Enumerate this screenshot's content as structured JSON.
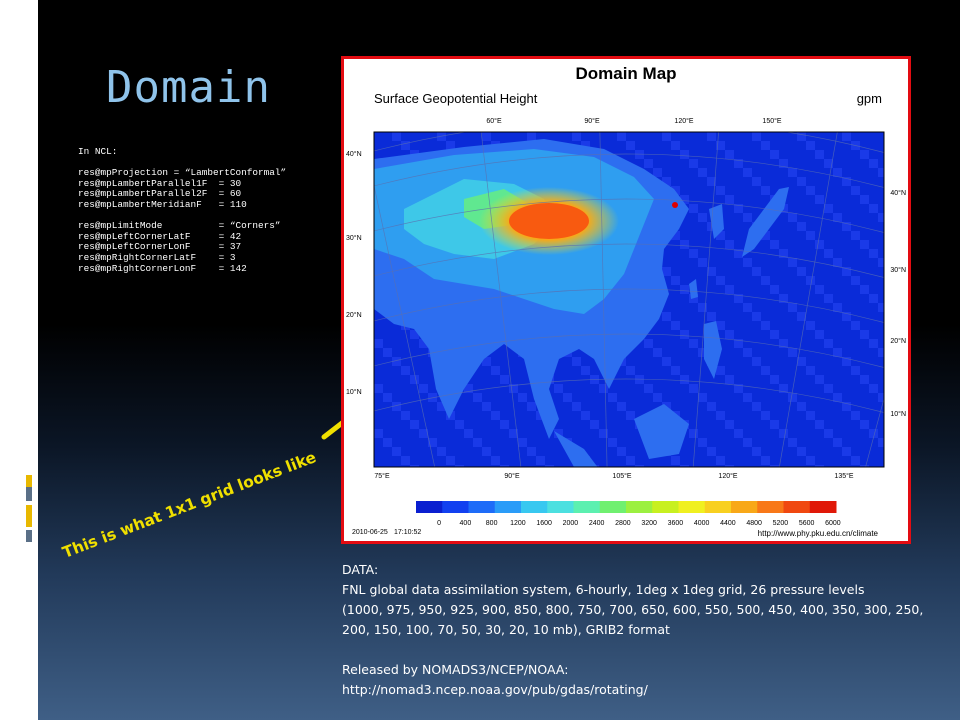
{
  "slide": {
    "title": "Domain",
    "code_lines": [
      "In NCL:",
      "",
      "res@mpProjection = “LambertConformal”",
      "res@mpLambertParallel1F  = 30",
      "res@mpLambertParallel2F  = 60",
      "res@mpLambertMeridianF   = 110",
      "",
      "res@mpLimitMode          = “Corners”",
      "res@mpLeftCornerLatF     = 42",
      "res@mpLeftCornerLonF     = 37",
      "res@mpRightCornerLatF    = 3",
      "res@mpRightCornerLonF    = 142"
    ],
    "caption": "This is what 1x1 grid looks like",
    "data_text": {
      "heading": "DATA:",
      "line1": "FNL global data assimilation system, 6-hourly, 1deg x 1deg grid, 26 pressure levels",
      "line2": "(1000, 975, 950, 925, 900, 850, 800, 750, 700, 650, 600, 550, 500, 450, 400, 350, 300, 250,",
      "line3": "200, 150, 100, 70, 50, 30, 20, 10 mb), GRIB2 format",
      "released": "Released by NOMADS3/NCEP/NOAA:",
      "url": "http://nomad3.ncep.noaa.gov/pub/gdas/rotating/"
    }
  },
  "map": {
    "title": "Domain Map",
    "subtitle": "Surface Geopotential Height",
    "units": "gpm",
    "top_lon_labels": [
      "60°E",
      "90°E",
      "120°E",
      "150°E"
    ],
    "bottom_lon_labels": [
      "75°E",
      "90°E",
      "105°E",
      "120°E",
      "135°E"
    ],
    "left_lat_labels": [
      "40°N",
      "30°N",
      "20°N",
      "10°N"
    ],
    "right_lat_labels": [
      "40°N",
      "30°N",
      "20°N",
      "10°N"
    ],
    "colorbar_ticks": [
      "0",
      "400",
      "800",
      "1200",
      "1600",
      "2000",
      "2400",
      "2800",
      "3200",
      "3600",
      "4000",
      "4400",
      "4800",
      "5200",
      "5600",
      "6000"
    ],
    "colorbar_colors": [
      "#0a1fd0",
      "#1240f0",
      "#1e6cf8",
      "#2a9cf8",
      "#38c8f0",
      "#4ce0e0",
      "#5cf0b0",
      "#70f070",
      "#9cf040",
      "#c8f020",
      "#f0f020",
      "#f8d020",
      "#f8a818",
      "#f87818",
      "#f04810",
      "#e01808"
    ],
    "date": "2010-06-25",
    "time": "17:10:52",
    "credit": "http://www.phy.pku.edu.cn/climate"
  }
}
